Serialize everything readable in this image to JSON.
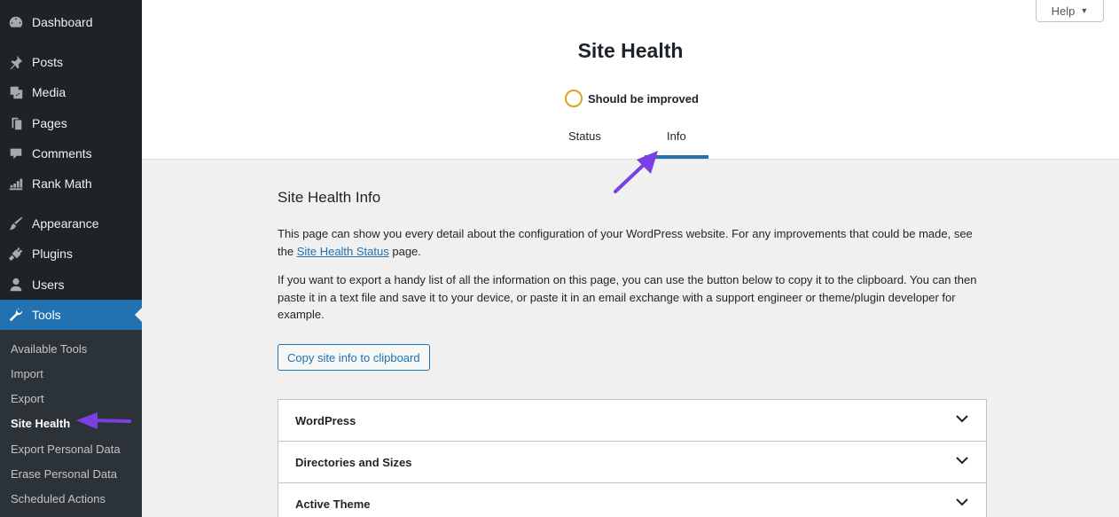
{
  "sidebar": {
    "items": [
      {
        "label": "Dashboard",
        "icon": "dashboard-icon"
      },
      {
        "label": "Posts",
        "icon": "pin-icon"
      },
      {
        "label": "Media",
        "icon": "media-icon"
      },
      {
        "label": "Pages",
        "icon": "page-icon"
      },
      {
        "label": "Comments",
        "icon": "comment-icon"
      },
      {
        "label": "Rank Math",
        "icon": "chart-icon"
      },
      {
        "label": "Appearance",
        "icon": "brush-icon"
      },
      {
        "label": "Plugins",
        "icon": "plug-icon"
      },
      {
        "label": "Users",
        "icon": "user-icon"
      },
      {
        "label": "Tools",
        "icon": "wrench-icon"
      }
    ],
    "submenu": [
      {
        "label": "Available Tools"
      },
      {
        "label": "Import"
      },
      {
        "label": "Export"
      },
      {
        "label": "Site Health"
      },
      {
        "label": "Export Personal Data"
      },
      {
        "label": "Erase Personal Data"
      },
      {
        "label": "Scheduled Actions"
      }
    ]
  },
  "header": {
    "help_label": "Help",
    "help_caret": "▼",
    "title": "Site Health",
    "status": "Should be improved",
    "tabs": [
      {
        "label": "Status"
      },
      {
        "label": "Info"
      }
    ]
  },
  "main": {
    "section_title": "Site Health Info",
    "para1_before": "This page can show you every detail about the configuration of your WordPress website. For any improvements that could be made, see the ",
    "para1_link": "Site Health Status",
    "para1_after": " page.",
    "para2": "If you want to export a handy list of all the information on this page, you can use the button below to copy it to the clipboard. You can then paste it in a text file and save it to your device, or paste it in an email exchange with a support engineer or theme/plugin developer for example.",
    "copy_button": "Copy site info to clipboard",
    "accordion": [
      {
        "label": "WordPress"
      },
      {
        "label": "Directories and Sizes"
      },
      {
        "label": "Active Theme"
      }
    ]
  },
  "colors": {
    "sidebar_bg": "#1d2327",
    "submenu_bg": "#2c3338",
    "accent": "#2271b1",
    "status_warning": "#dba617",
    "annotation_arrow": "#7b3fe4"
  }
}
